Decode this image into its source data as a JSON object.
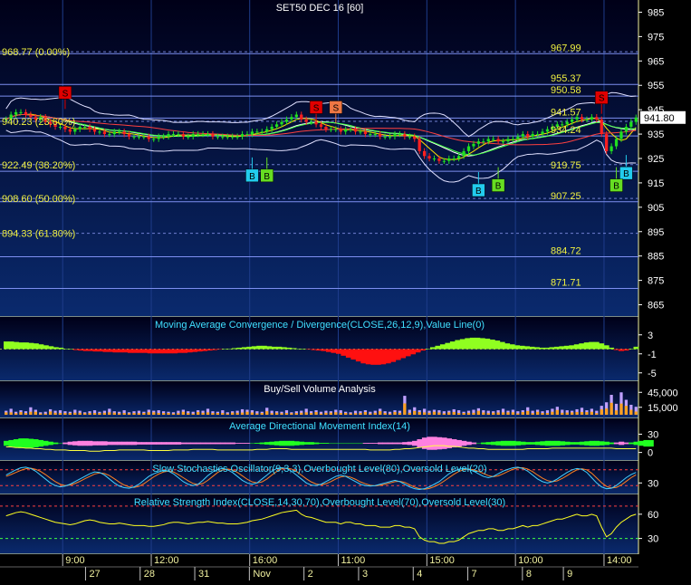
{
  "chart_data": [
    {
      "type": "candlestick",
      "title": "SET50 DEC 16  [60]",
      "ylim": [
        860,
        990
      ],
      "yticks": [
        985,
        975,
        965,
        955,
        945,
        935,
        925,
        915,
        905,
        895,
        885,
        875,
        865
      ],
      "last_price": "941.80",
      "fib_levels": [
        {
          "label": "968.77 (0.00%)",
          "value": 968.77
        },
        {
          "label": "940.23 (23.60%)",
          "value": 940.23
        },
        {
          "label": "922.49 (38.20%)",
          "value": 922.49
        },
        {
          "label": "908.60 (50.00%)",
          "value": 908.6
        },
        {
          "label": "894.33 (61.80%)",
          "value": 894.33
        }
      ],
      "price_levels": [
        {
          "label": "967.99",
          "value": 967.99
        },
        {
          "label": "955.37",
          "value": 955.37
        },
        {
          "label": "950.58",
          "value": 950.58
        },
        {
          "label": "941.57",
          "value": 941.57
        },
        {
          "label": "934.24",
          "value": 934.24
        },
        {
          "label": "919.75",
          "value": 919.75
        },
        {
          "label": "907.25",
          "value": 907.25
        },
        {
          "label": "884.72",
          "value": 884.72
        },
        {
          "label": "871.71",
          "value": 871.71
        }
      ],
      "signals": [
        {
          "type": "S",
          "bar": 12,
          "value": 952,
          "color": "#e00000"
        },
        {
          "type": "B",
          "bar": 50,
          "value": 918,
          "color": "#22ccee"
        },
        {
          "type": "B",
          "bar": 53,
          "value": 918,
          "color": "#66dd22"
        },
        {
          "type": "S",
          "bar": 63,
          "value": 946,
          "color": "#e00000"
        },
        {
          "type": "S",
          "bar": 67,
          "value": 946,
          "color": "#ee7744"
        },
        {
          "type": "B",
          "bar": 96,
          "value": 912,
          "color": "#22ccee"
        },
        {
          "type": "B",
          "bar": 100,
          "value": 914,
          "color": "#66dd22"
        },
        {
          "type": "S",
          "bar": 121,
          "value": 950,
          "color": "#e00000"
        },
        {
          "type": "B",
          "bar": 126,
          "value": 919,
          "color": "#22ccee"
        },
        {
          "type": "B",
          "bar": 124,
          "value": 914,
          "color": "#66dd22"
        }
      ],
      "close": [
        941,
        943,
        944,
        944,
        943,
        942,
        941,
        942,
        940,
        939,
        938,
        938,
        937,
        936,
        937,
        938,
        938,
        937,
        936,
        936,
        935,
        935,
        936,
        936,
        935,
        934,
        934,
        934,
        934,
        933,
        933,
        934,
        934,
        935,
        935,
        935,
        934,
        934,
        935,
        935,
        935,
        935,
        934,
        934,
        934,
        934,
        934,
        934,
        935,
        935,
        936,
        936,
        936,
        937,
        938,
        939,
        940,
        941,
        942,
        943,
        941,
        940,
        940,
        939,
        938,
        937,
        937,
        937,
        936,
        937,
        937,
        936,
        936,
        935,
        935,
        935,
        934,
        934,
        934,
        935,
        935,
        934,
        934,
        933,
        928,
        926,
        925,
        925,
        924,
        924,
        925,
        925,
        926,
        928,
        930,
        931,
        932,
        932,
        933,
        933,
        932,
        932,
        933,
        933,
        934,
        935,
        934,
        935,
        935,
        936,
        937,
        938,
        939,
        939,
        940,
        941,
        942,
        941,
        941,
        942,
        941,
        935,
        928,
        930,
        933,
        936,
        938,
        940,
        941.8
      ]
    },
    {
      "type": "histogram",
      "title": "Moving Average Convergence / Divergence(CLOSE,26,12,9),Value Line(0)",
      "ylim": [
        -6,
        6
      ],
      "yticks": [
        3,
        -1,
        -5
      ],
      "values": [
        1.6,
        1.6,
        1.5,
        1.4,
        1.4,
        1.3,
        1.2,
        1.0,
        0.8,
        0.6,
        0.4,
        0.3,
        0.1,
        0.0,
        -0.2,
        -0.3,
        -0.4,
        -0.4,
        -0.5,
        -0.5,
        -0.6,
        -0.6,
        -0.7,
        -0.7,
        -0.7,
        -0.8,
        -0.8,
        -0.8,
        -0.8,
        -0.9,
        -0.9,
        -0.9,
        -0.9,
        -0.9,
        -0.9,
        -0.8,
        -0.8,
        -0.7,
        -0.6,
        -0.5,
        -0.4,
        -0.3,
        -0.2,
        -0.1,
        0.0,
        0.1,
        0.2,
        0.3,
        0.4,
        0.5,
        0.6,
        0.7,
        0.7,
        0.6,
        0.5,
        0.5,
        0.4,
        0.3,
        0.2,
        0.1,
        0.0,
        -0.1,
        -0.2,
        -0.3,
        -0.4,
        -0.6,
        -0.8,
        -1.0,
        -1.4,
        -1.8,
        -2.2,
        -2.6,
        -3.0,
        -3.2,
        -3.3,
        -3.3,
        -3.2,
        -3.0,
        -2.7,
        -2.3,
        -1.9,
        -1.5,
        -1.1,
        -0.7,
        -0.3,
        0.1,
        0.4,
        0.7,
        1.0,
        1.3,
        1.6,
        1.9,
        2.1,
        2.3,
        2.4,
        2.4,
        2.3,
        2.2,
        2.0,
        1.8,
        1.5,
        1.2,
        1.0,
        0.8,
        0.7,
        0.6,
        0.5,
        0.4,
        0.3,
        0.3,
        0.4,
        0.5,
        0.6,
        0.7,
        0.8,
        1.0,
        1.2,
        1.4,
        1.5,
        1.5,
        1.2,
        0.8,
        0.3,
        -0.2,
        -0.4,
        -0.3,
        0.1,
        0.5
      ]
    },
    {
      "type": "bar",
      "title": "Buy/Sell Volume Analysis",
      "ylim": [
        0,
        60000
      ],
      "yticks": [
        45000,
        15000
      ],
      "volume": [
        8000,
        12000,
        6000,
        9000,
        7000,
        15000,
        10000,
        5000,
        6000,
        11000,
        8000,
        9000,
        7000,
        6000,
        10000,
        8000,
        5000,
        7000,
        9000,
        6000,
        8000,
        12000,
        7000,
        6000,
        9000,
        5000,
        7000,
        8000,
        6000,
        10000,
        8000,
        9000,
        7000,
        6000,
        5000,
        8000,
        10000,
        7000,
        6000,
        9000,
        8000,
        12000,
        7000,
        6000,
        9000,
        5000,
        7000,
        8000,
        11000,
        10000,
        9000,
        7000,
        6000,
        14000,
        8000,
        7000,
        6000,
        9000,
        5000,
        7000,
        8000,
        12000,
        7000,
        9000,
        6000,
        8000,
        7000,
        10000,
        9000,
        6000,
        5000,
        8000,
        7000,
        9000,
        6000,
        8000,
        12000,
        7000,
        6000,
        9000,
        8000,
        38000,
        10000,
        15000,
        9000,
        12000,
        8000,
        10000,
        9000,
        7000,
        8000,
        11000,
        9000,
        6000,
        8000,
        10000,
        13000,
        9000,
        8000,
        7000,
        9000,
        12000,
        8000,
        10000,
        7000,
        9000,
        15000,
        8000,
        10000,
        7000,
        9000,
        12000,
        16000,
        10000,
        9000,
        8000,
        11000,
        14000,
        9000,
        12000,
        8000,
        18000,
        25000,
        40000,
        22000,
        45000,
        30000,
        20000,
        16000
      ],
      "buy_share": [
        0.6,
        0.4,
        0.5,
        0.6,
        0.5,
        0.4,
        0.6,
        0.5,
        0.4,
        0.6,
        0.5,
        0.4,
        0.5,
        0.6,
        0.4,
        0.5,
        0.6,
        0.5,
        0.4,
        0.6,
        0.5,
        0.4,
        0.6,
        0.5,
        0.4,
        0.6,
        0.5,
        0.4,
        0.6,
        0.5,
        0.6,
        0.4,
        0.5,
        0.6,
        0.5,
        0.4,
        0.6,
        0.5,
        0.4,
        0.6,
        0.5,
        0.4,
        0.5,
        0.6,
        0.4,
        0.5,
        0.6,
        0.5,
        0.4,
        0.6,
        0.5,
        0.4,
        0.6,
        0.5,
        0.4,
        0.6,
        0.5,
        0.4,
        0.6,
        0.5,
        0.5,
        0.4,
        0.5,
        0.6,
        0.4,
        0.5,
        0.6,
        0.5,
        0.4,
        0.6,
        0.5,
        0.4,
        0.5,
        0.6,
        0.4,
        0.5,
        0.6,
        0.5,
        0.4,
        0.6,
        0.5,
        0.6,
        0.4,
        0.5,
        0.6,
        0.4,
        0.5,
        0.6,
        0.5,
        0.4,
        0.6,
        0.5,
        0.4,
        0.6,
        0.5,
        0.4,
        0.6,
        0.5,
        0.4,
        0.6,
        0.5,
        0.4,
        0.6,
        0.5,
        0.4,
        0.6,
        0.5,
        0.4,
        0.6,
        0.5,
        0.4,
        0.5,
        0.6,
        0.4,
        0.5,
        0.6,
        0.5,
        0.4,
        0.6,
        0.5,
        0.4,
        0.6,
        0.5,
        0.6,
        0.4,
        0.5,
        0.6,
        0.5,
        0.4
      ]
    },
    {
      "type": "area",
      "title": "Average Directional Movement Index(14)",
      "ylim": [
        -8,
        50
      ],
      "yticks": [
        30,
        0
      ],
      "adx": [
        18,
        18,
        17,
        17,
        16,
        16,
        15,
        15,
        14,
        14,
        13,
        13,
        13,
        12,
        12,
        12,
        12,
        11,
        11,
        11,
        12,
        12,
        12,
        13,
        13,
        13,
        13,
        13,
        13,
        12,
        12,
        12,
        12,
        12,
        13,
        13,
        13,
        13,
        14,
        14,
        14,
        14,
        14,
        13,
        13,
        13,
        13,
        13,
        13,
        13,
        13,
        14,
        14,
        14,
        15,
        15,
        15,
        15,
        14,
        14,
        14,
        14,
        14,
        14,
        14,
        14,
        14,
        14,
        14,
        14,
        14,
        14,
        14,
        14,
        13,
        13,
        13,
        13,
        13,
        14,
        14,
        15,
        15,
        16,
        17,
        18,
        19,
        20,
        20,
        20,
        19,
        19,
        18,
        17,
        16,
        16,
        15,
        15,
        14,
        14,
        14,
        14,
        14,
        14,
        14,
        14,
        15,
        15,
        15,
        15,
        15,
        16,
        16,
        16,
        16,
        16,
        16,
        16,
        16,
        16,
        16,
        16,
        16,
        16,
        15,
        15,
        15,
        15,
        15
      ],
      "spread": [
        6,
        8,
        10,
        12,
        12,
        11,
        10,
        8,
        6,
        4,
        2,
        0,
        -2,
        -4,
        -5,
        -6,
        -6,
        -6,
        -5,
        -5,
        -5,
        -4,
        -4,
        -4,
        -4,
        -4,
        -4,
        -3,
        -3,
        -3,
        -3,
        -3,
        -3,
        -3,
        -3,
        -3,
        -2,
        -2,
        -2,
        -2,
        -2,
        -2,
        -2,
        -2,
        -2,
        -2,
        -2,
        -1,
        -1,
        -1,
        0,
        1,
        2,
        3,
        4,
        5,
        6,
        6,
        6,
        5,
        4,
        3,
        3,
        2,
        1,
        1,
        0,
        0,
        0,
        0,
        0,
        0,
        0,
        -1,
        -1,
        -1,
        -2,
        -2,
        -2,
        -2,
        -2,
        -3,
        -4,
        -6,
        -10,
        -14,
        -16,
        -16,
        -15,
        -14,
        -12,
        -10,
        -8,
        -6,
        -4,
        -2,
        0,
        2,
        3,
        4,
        5,
        6,
        6,
        6,
        5,
        4,
        3,
        3,
        4,
        5,
        6,
        6,
        6,
        5,
        4,
        3,
        3,
        4,
        5,
        6,
        6,
        5,
        4,
        2,
        -2,
        -4,
        -2,
        2,
        4,
        6,
        8,
        8
      ]
    },
    {
      "type": "line",
      "title": "Slow Stochastics Oscillator(9,3,3),Overbought Level(80),Oversold Level(20)",
      "ylim": [
        0,
        100
      ],
      "yticks": [
        30
      ],
      "levels": [
        80,
        20
      ],
      "k": [
        60,
        70,
        80,
        88,
        90,
        85,
        75,
        60,
        45,
        30,
        20,
        15,
        18,
        25,
        35,
        45,
        55,
        65,
        72,
        70,
        60,
        45,
        30,
        18,
        12,
        10,
        15,
        25,
        40,
        55,
        65,
        72,
        78,
        75,
        65,
        50,
        35,
        25,
        20,
        25,
        40,
        58,
        72,
        82,
        85,
        80,
        70,
        55,
        40,
        30,
        25,
        30,
        45,
        60,
        75,
        85,
        88,
        85,
        75,
        60,
        45,
        30,
        22,
        20,
        25,
        35,
        45,
        55,
        60,
        55,
        45,
        35,
        25,
        20,
        18,
        20,
        25,
        30,
        35,
        40,
        35,
        25,
        15,
        8,
        5,
        8,
        15,
        25,
        35,
        50,
        65,
        75,
        82,
        85,
        82,
        75,
        65,
        55,
        50,
        55,
        65,
        75,
        82,
        88,
        90,
        85,
        75,
        60,
        45,
        35,
        30,
        35,
        45,
        58,
        70,
        80,
        85,
        82,
        70,
        50,
        30,
        15,
        8,
        10,
        20,
        35,
        50,
        62,
        70
      ],
      "d": [
        55,
        62,
        70,
        78,
        84,
        86,
        82,
        74,
        62,
        48,
        35,
        25,
        20,
        22,
        28,
        36,
        46,
        55,
        64,
        68,
        66,
        58,
        46,
        33,
        22,
        15,
        13,
        17,
        27,
        40,
        53,
        64,
        72,
        75,
        72,
        62,
        50,
        38,
        28,
        24,
        28,
        40,
        55,
        70,
        80,
        83,
        80,
        70,
        57,
        44,
        34,
        30,
        34,
        45,
        60,
        74,
        84,
        86,
        83,
        74,
        60,
        46,
        34,
        26,
        23,
        27,
        35,
        45,
        53,
        56,
        52,
        44,
        34,
        27,
        21,
        19,
        21,
        25,
        30,
        35,
        36,
        32,
        23,
        14,
        8,
        6,
        9,
        16,
        25,
        37,
        50,
        63,
        74,
        80,
        83,
        80,
        74,
        66,
        58,
        54,
        57,
        65,
        74,
        82,
        87,
        88,
        83,
        73,
        60,
        48,
        39,
        35,
        38,
        47,
        58,
        70,
        80,
        84,
        80,
        67,
        49,
        31,
        17,
        11,
        13,
        22,
        36,
        50,
        61
      ]
    },
    {
      "type": "line",
      "title": "Relative Strength Index(CLOSE,14,30,70),Overbought Level(70),Oversold Level(30)",
      "ylim": [
        15,
        80
      ],
      "yticks": [
        60,
        30
      ],
      "levels": [
        70,
        30
      ],
      "rsi": [
        58,
        60,
        62,
        63,
        62,
        60,
        58,
        56,
        54,
        52,
        50,
        49,
        48,
        47,
        48,
        50,
        52,
        53,
        52,
        50,
        49,
        48,
        48,
        49,
        48,
        47,
        46,
        46,
        46,
        45,
        45,
        46,
        47,
        49,
        50,
        50,
        49,
        48,
        49,
        50,
        50,
        51,
        50,
        49,
        49,
        48,
        48,
        48,
        49,
        50,
        52,
        53,
        54,
        56,
        58,
        60,
        62,
        63,
        64,
        65,
        60,
        57,
        56,
        54,
        52,
        50,
        50,
        50,
        48,
        50,
        50,
        48,
        48,
        46,
        46,
        46,
        44,
        44,
        44,
        46,
        46,
        44,
        44,
        42,
        32,
        28,
        26,
        26,
        24,
        24,
        26,
        26,
        28,
        32,
        36,
        38,
        40,
        40,
        42,
        42,
        40,
        40,
        42,
        42,
        44,
        46,
        44,
        46,
        46,
        48,
        50,
        52,
        54,
        54,
        56,
        58,
        60,
        58,
        58,
        60,
        58,
        44,
        32,
        36,
        44,
        50,
        54,
        58,
        60
      ],
      "xticks_time": [
        {
          "label": "9:00",
          "bar": 12
        },
        {
          "label": "12:00",
          "bar": 30
        },
        {
          "label": "16:00",
          "bar": 50
        },
        {
          "label": "11:00",
          "bar": 68
        },
        {
          "label": "15:00",
          "bar": 86
        },
        {
          "label": "10:00",
          "bar": 104
        },
        {
          "label": "14:00",
          "bar": 122
        }
      ],
      "xticks_date": [
        {
          "label": "27",
          "bar": 12
        },
        {
          "label": "28",
          "bar": 20
        },
        {
          "label": "31",
          "bar": 28
        },
        {
          "label": "Nov",
          "bar": 36
        },
        {
          "label": "2",
          "bar": 44
        },
        {
          "label": "3",
          "bar": 52
        },
        {
          "label": "4",
          "bar": 60
        },
        {
          "label": "7",
          "bar": 68
        },
        {
          "label": "8",
          "bar": 76
        },
        {
          "label": "9",
          "bar": 82
        }
      ]
    }
  ]
}
